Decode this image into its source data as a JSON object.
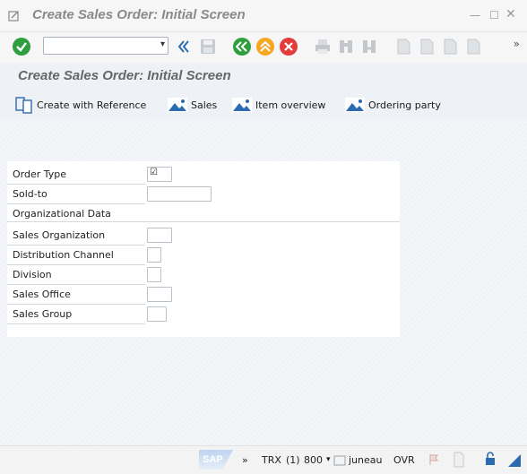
{
  "window": {
    "title": "Create Sales Order: Initial Screen",
    "controls": [
      "minimize-icon",
      "maximize-icon",
      "close-icon"
    ]
  },
  "toolbar": {
    "command_field": {
      "value": "",
      "placeholder": ""
    },
    "more": "»"
  },
  "page": {
    "title": "Create Sales Order: Initial Screen"
  },
  "appbar": {
    "create_with_reference": "Create with Reference",
    "sales": "Sales",
    "item_overview": "Item overview",
    "ordering_party": "Ordering party"
  },
  "form": {
    "order_type": {
      "label": "Order Type",
      "value": ""
    },
    "sold_to": {
      "label": "Sold-to",
      "value": ""
    },
    "section": "Organizational Data",
    "sales_org": {
      "label": "Sales Organization",
      "value": ""
    },
    "distribution_channel": {
      "label": "Distribution Channel",
      "value": ""
    },
    "division": {
      "label": "Division",
      "value": ""
    },
    "sales_office": {
      "label": "Sales Office",
      "value": ""
    },
    "sales_group": {
      "label": "Sales Group",
      "value": ""
    }
  },
  "status": {
    "more": "»",
    "transaction": "TRX",
    "session": "(1)",
    "client": "800",
    "user": "juneau",
    "mode": "OVR",
    "logo": "SAP"
  },
  "colors": {
    "accept_green": "#2e9e3e",
    "nav_green": "#2e9e3e",
    "exit_orange": "#f5a623",
    "cancel_red": "#e43b3b",
    "icon_blue": "#2b6cb0"
  }
}
